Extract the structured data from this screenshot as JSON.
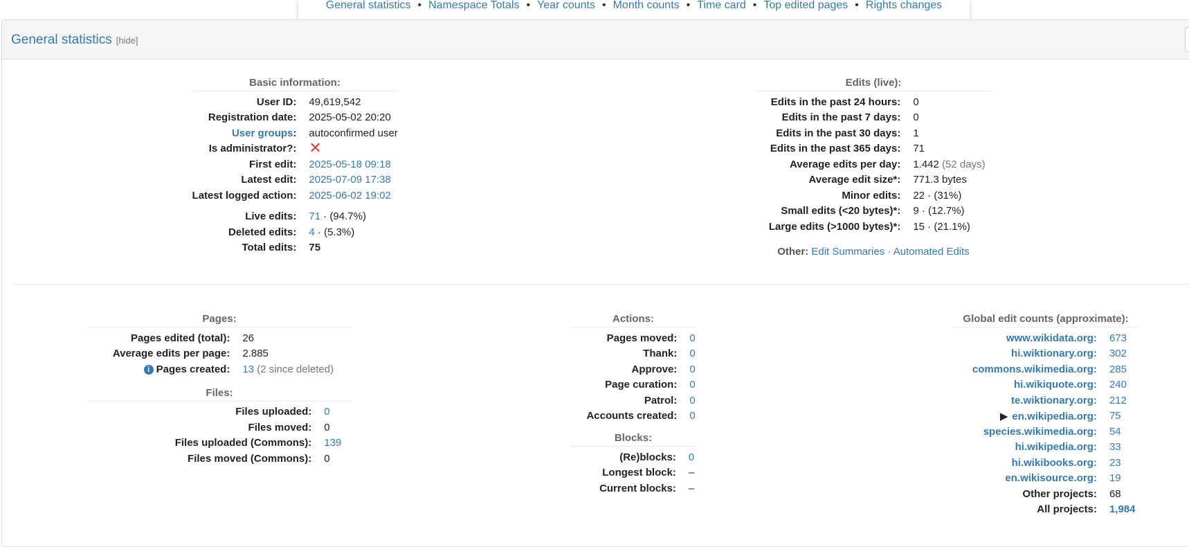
{
  "topnav": {
    "items": [
      "General statistics",
      "Namespace Totals",
      "Year counts",
      "Month counts",
      "Time card",
      "Top edited pages",
      "Rights changes"
    ]
  },
  "panel": {
    "title": "General statistics",
    "hide_label": "[hide]"
  },
  "basic": {
    "caption": "Basic information:",
    "user_id_label": "User ID:",
    "user_id": "49,619,542",
    "reg_label": "Registration date:",
    "reg": "2025-05-02 20:20",
    "groups_label": "User groups",
    "groups": "autoconfirmed user",
    "admin_label": "Is administrator?:",
    "admin_icon": "✕",
    "first_label": "First edit:",
    "first": "2025-05-18 09:18",
    "latest_label": "Latest edit:",
    "latest": "2025-07-09 17:38",
    "logged_label": "Latest logged action:",
    "logged": "2025-06-02 19:02",
    "live_label": "Live edits:",
    "live": "71",
    "live_pct": "· (94.7%)",
    "deleted_label": "Deleted edits:",
    "deleted": "4",
    "deleted_pct": "· (5.3%)",
    "total_label": "Total edits:",
    "total": "75"
  },
  "edits": {
    "caption": "Edits (live):",
    "rows": [
      {
        "k": "Edits in the past 24 hours:",
        "v": "0",
        "extra": ""
      },
      {
        "k": "Edits in the past 7 days:",
        "v": "0",
        "extra": ""
      },
      {
        "k": "Edits in the past 30 days:",
        "v": "1",
        "extra": ""
      },
      {
        "k": "Edits in the past 365 days:",
        "v": "71",
        "extra": ""
      },
      {
        "k": "Average edits per day:",
        "v": "1.442",
        "extra": "(52 days)"
      },
      {
        "k": "Average edit size*:",
        "v": "771.3 bytes",
        "extra": ""
      },
      {
        "k": "Minor edits:",
        "v": "22 · (31%)",
        "extra": ""
      },
      {
        "k": "Small edits (<20 bytes)*:",
        "v": "9 · (12.7%)",
        "extra": ""
      },
      {
        "k": "Large edits (>1000 bytes)*:",
        "v": "15 · (21.1%)",
        "extra": ""
      }
    ],
    "other_label": "Other:",
    "other_link1": "Edit Summaries",
    "other_sep": " · ",
    "other_link2": "Automated Edits"
  },
  "pages": {
    "caption": "Pages:",
    "edited_label": "Pages edited (total):",
    "edited": "26",
    "avg_label": "Average edits per page:",
    "avg": "2.885",
    "created_label": "Pages created:",
    "created": "13",
    "created_extra": "(2 since deleted)"
  },
  "files": {
    "caption": "Files:",
    "rows": [
      {
        "k": "Files uploaded:",
        "v": "0",
        "link": true
      },
      {
        "k": "Files moved:",
        "v": "0",
        "link": false
      },
      {
        "k": "Files uploaded (Commons):",
        "v": "139",
        "link": true
      },
      {
        "k": "Files moved (Commons):",
        "v": "0",
        "link": false
      }
    ]
  },
  "actions": {
    "caption": "Actions:",
    "rows": [
      {
        "k": "Pages moved:",
        "v": "0"
      },
      {
        "k": "Thank:",
        "v": "0"
      },
      {
        "k": "Approve:",
        "v": "0"
      },
      {
        "k": "Page curation:",
        "v": "0"
      },
      {
        "k": "Patrol:",
        "v": "0"
      },
      {
        "k": "Accounts created:",
        "v": "0"
      }
    ]
  },
  "blocks": {
    "caption": "Blocks:",
    "rows": [
      {
        "k": "(Re)blocks:",
        "v": "0",
        "link": true
      },
      {
        "k": "Longest block:",
        "v": "–",
        "link": false
      },
      {
        "k": "Current blocks:",
        "v": "–",
        "link": false
      }
    ]
  },
  "global": {
    "caption": "Global edit counts (approximate):",
    "rows": [
      {
        "k": "www.wikidata.org:",
        "v": "673",
        "arrow": ""
      },
      {
        "k": "hi.wiktionary.org:",
        "v": "302",
        "arrow": ""
      },
      {
        "k": "commons.wikimedia.org:",
        "v": "285",
        "arrow": ""
      },
      {
        "k": "hi.wikiquote.org:",
        "v": "240",
        "arrow": ""
      },
      {
        "k": "te.wiktionary.org:",
        "v": "212",
        "arrow": ""
      },
      {
        "k": "en.wikipedia.org:",
        "v": "75",
        "arrow": "▶"
      },
      {
        "k": "species.wikimedia.org:",
        "v": "54",
        "arrow": ""
      },
      {
        "k": "hi.wikipedia.org:",
        "v": "33",
        "arrow": ""
      },
      {
        "k": "hi.wikibooks.org:",
        "v": "23",
        "arrow": ""
      },
      {
        "k": "en.wikisource.org:",
        "v": "19",
        "arrow": ""
      }
    ],
    "other_label": "Other projects:",
    "other": "68",
    "all_label": "All projects:",
    "all": "1,984"
  }
}
